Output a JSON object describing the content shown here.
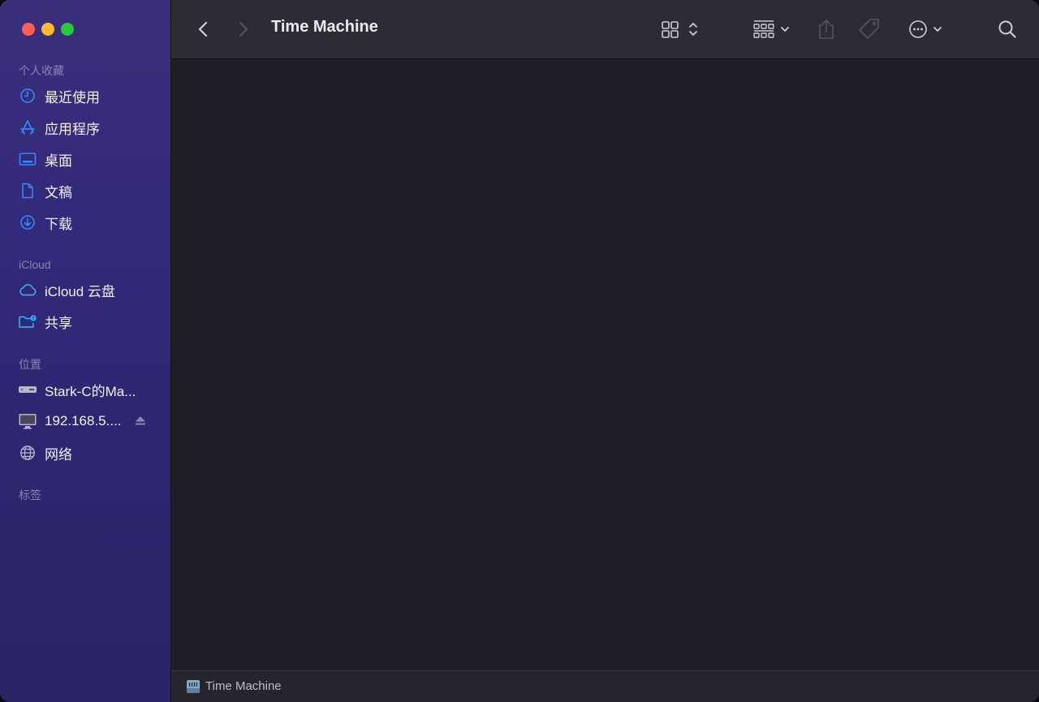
{
  "window": {
    "title": "Time Machine"
  },
  "sidebar": {
    "sections": [
      {
        "label": "个人收藏"
      },
      {
        "label": "iCloud"
      },
      {
        "label": "位置"
      },
      {
        "label": "标签"
      }
    ],
    "favorites": [
      {
        "label": "最近使用",
        "icon": "clock-icon"
      },
      {
        "label": "应用程序",
        "icon": "applications-icon"
      },
      {
        "label": "桌面",
        "icon": "desktop-icon"
      },
      {
        "label": "文稿",
        "icon": "document-icon"
      },
      {
        "label": "下载",
        "icon": "download-icon"
      }
    ],
    "icloud": [
      {
        "label": "iCloud 云盘",
        "icon": "cloud-icon"
      },
      {
        "label": "共享",
        "icon": "shared-folder-icon"
      }
    ],
    "locations": [
      {
        "label": "Stark-C的Ma...",
        "icon": "mac-mini-icon"
      },
      {
        "label": "192.168.5....",
        "icon": "display-icon",
        "ejectable": true
      },
      {
        "label": "网络",
        "icon": "globe-icon"
      }
    ]
  },
  "pathbar": {
    "label": "Time Machine",
    "icon": "time-machine-drive-icon"
  },
  "colors": {
    "accent": "#2f8bff",
    "icloud_accent": "#35b7ff",
    "sidebar_top": "#3a2f7a",
    "sidebar_bottom": "#2a2466",
    "content_bg": "#1f1e27",
    "toolbar_bg": "#2d2c34"
  }
}
